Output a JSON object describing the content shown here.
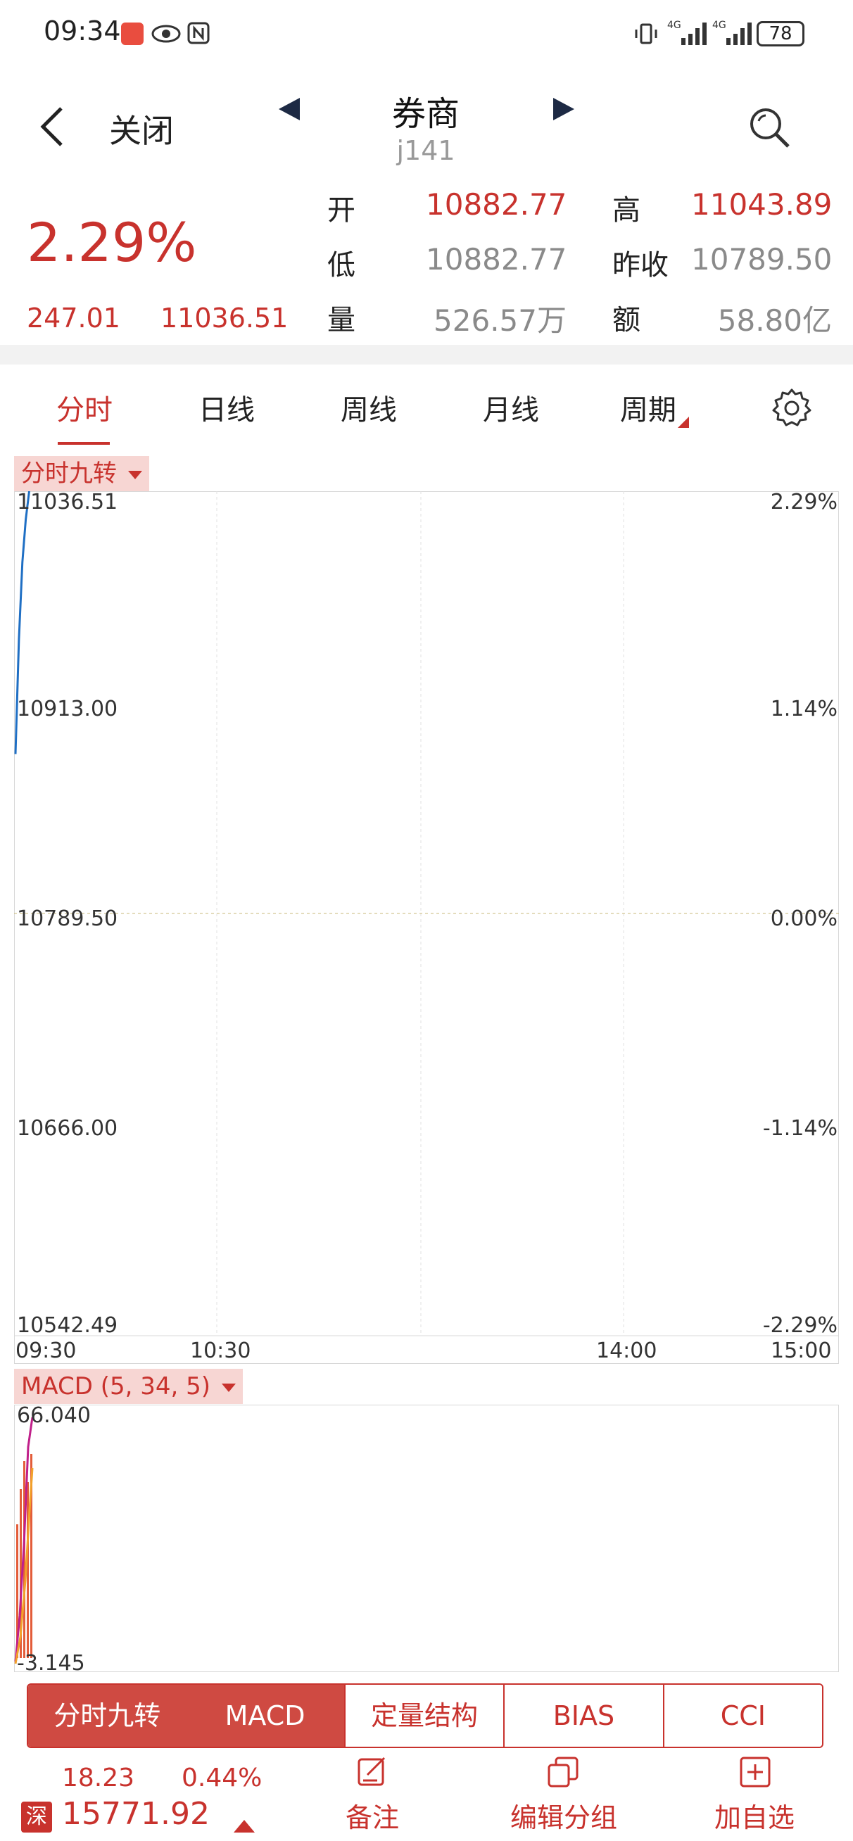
{
  "status_bar": {
    "time": "09:34",
    "battery": "78"
  },
  "header": {
    "close_label": "关闭",
    "title": "券商",
    "code": "j141"
  },
  "quote": {
    "change_pct": "2.29%",
    "change_value": "247.01",
    "price": "11036.51",
    "rows": [
      {
        "label_left": "开",
        "value_left": "10882.77",
        "label_right": "高",
        "value_right": "11043.89"
      },
      {
        "label_left": "低",
        "value_left": "10882.77",
        "label_right": "昨收",
        "value_right": "10789.50"
      },
      {
        "label_left": "量",
        "value_left": "526.57万",
        "label_right": "额",
        "value_right": "58.80亿"
      }
    ]
  },
  "tabs": [
    {
      "label": "分时"
    },
    {
      "label": "日线"
    },
    {
      "label": "周线"
    },
    {
      "label": "月线"
    },
    {
      "label": "周期"
    }
  ],
  "colors": {
    "accent": "#c8322d",
    "price_line": "#1f6fc4",
    "macd_line": "#c0208a"
  },
  "chart_data": [
    {
      "type": "line",
      "indicator_label": "分时九转",
      "y_left_ticks": [
        "11036.51",
        "10913.00",
        "10789.50",
        "10666.00",
        "10542.49"
      ],
      "y_right_ticks": [
        "2.29%",
        "1.14%",
        "0.00%",
        "-1.14%",
        "-2.29%"
      ],
      "x_ticks": [
        "09:30",
        "10:30",
        "14:00",
        "15:00"
      ],
      "ylim": [
        10542.49,
        11036.51
      ],
      "baseline": 10789.5,
      "series": [
        {
          "x": [
            "09:30",
            "09:31",
            "09:32",
            "09:33",
            "09:34"
          ],
          "values": [
            10882.77,
            10950,
            10995,
            11020,
            11036.51
          ]
        }
      ]
    },
    {
      "type": "bar",
      "indicator_label": "MACD (5, 34, 5)",
      "y_ticks": [
        "66.040",
        "-3.145"
      ],
      "ylim": [
        -3.145,
        66.04
      ]
    }
  ],
  "indicator_tabs": [
    {
      "label": "分时九转"
    },
    {
      "label": "MACD"
    },
    {
      "label": "定量结构"
    },
    {
      "label": "BIAS"
    },
    {
      "label": "CCI"
    }
  ],
  "bottom_bar": {
    "change_value": "18.23",
    "change_pct": "0.44%",
    "market_badge": "深",
    "index_value": "15771.92",
    "actions": [
      {
        "label": "备注",
        "icon": "note-edit-icon"
      },
      {
        "label": "编辑分组",
        "icon": "copy-group-icon"
      },
      {
        "label": "加自选",
        "icon": "add-plus-icon"
      }
    ]
  }
}
